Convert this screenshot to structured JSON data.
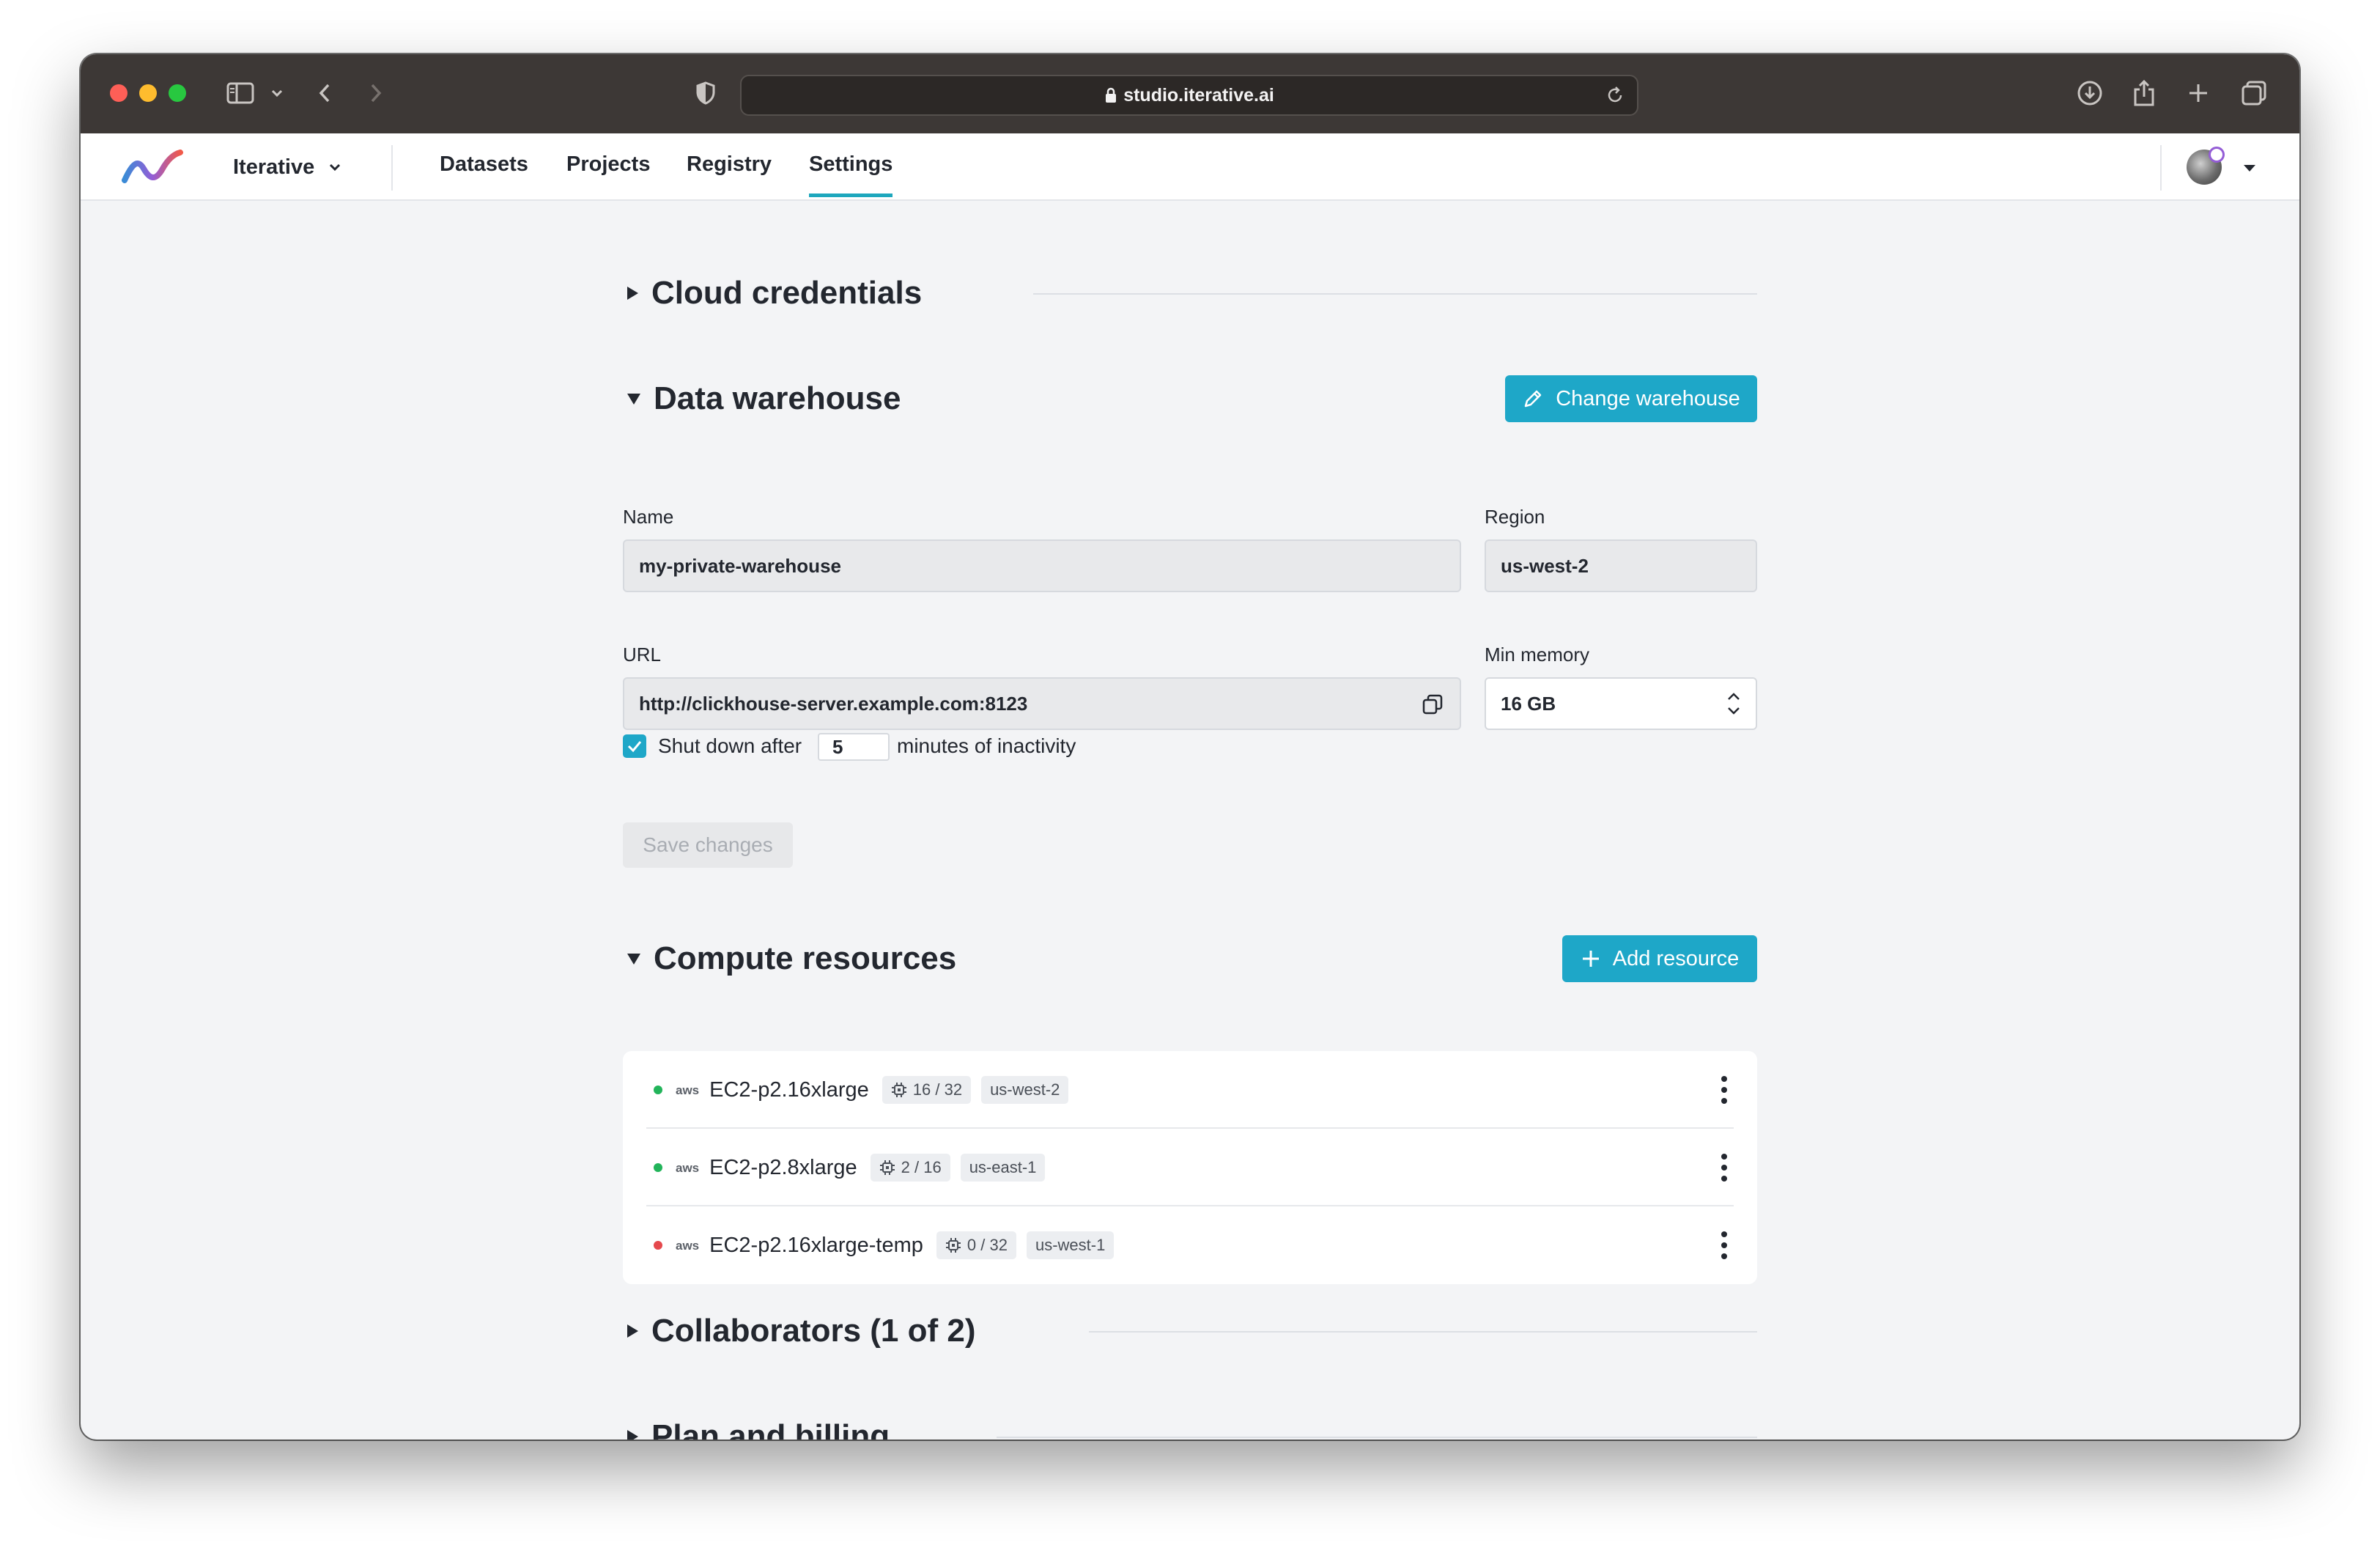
{
  "browser": {
    "url": "studio.iterative.ai"
  },
  "nav": {
    "org_label": "Iterative",
    "tabs": [
      {
        "label": "Datasets"
      },
      {
        "label": "Projects"
      },
      {
        "label": "Registry"
      },
      {
        "label": "Settings"
      }
    ],
    "active_tab": "Settings"
  },
  "sections": {
    "cloud_credentials": "Cloud credentials",
    "data_warehouse": "Data warehouse",
    "compute_resources": "Compute resources",
    "collaborators": "Collaborators (1 of 2)",
    "plan_billing": "Plan and billing"
  },
  "warehouse": {
    "change_button": "Change warehouse",
    "name_label": "Name",
    "name_value": "my-private-warehouse",
    "region_label": "Region",
    "region_value": "us-west-2",
    "url_label": "URL",
    "url_value": "http://clickhouse-server.example.com:8123",
    "memory_label": "Min memory",
    "memory_value": "16 GB",
    "shutdown_prefix": "Shut down after",
    "shutdown_minutes": "5",
    "shutdown_suffix": "minutes of inactivity",
    "shutdown_checked": true,
    "save_button": "Save changes"
  },
  "compute": {
    "add_button": "Add resource",
    "provider_label": "aws",
    "resources": [
      {
        "name": "EC2-p2.16xlarge",
        "usage": "16 / 32",
        "region": "us-west-2",
        "status_color": "#22b45a"
      },
      {
        "name": "EC2-p2.8xlarge",
        "usage": "2 / 16",
        "region": "us-east-1",
        "status_color": "#22b45a"
      },
      {
        "name": "EC2-p2.16xlarge-temp",
        "usage": "0 / 32",
        "region": "us-west-1",
        "status_color": "#e5484d"
      }
    ]
  },
  "colors": {
    "accent": "#1ea7c8",
    "titlebar": "#3d3836",
    "page_bg": "#f3f4f6"
  }
}
